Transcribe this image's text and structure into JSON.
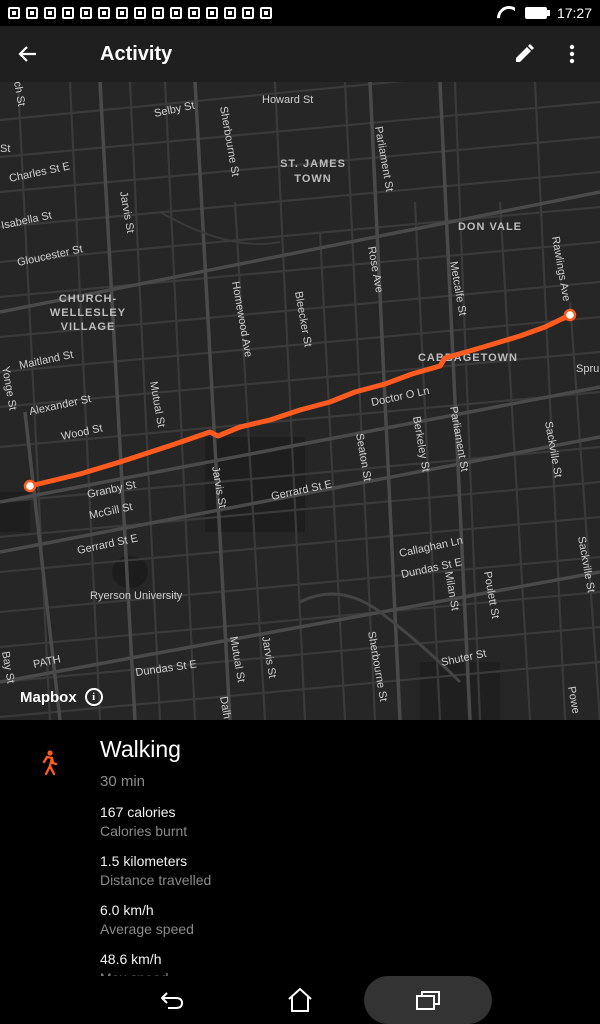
{
  "status_bar": {
    "time": "17:27"
  },
  "app_bar": {
    "title": "Activity"
  },
  "map": {
    "attribution": "Mapbox",
    "route_color": "#ff5a1f",
    "labels": {
      "howard_st": "Howard St",
      "selby_st": "Selby St",
      "charles_st_e": "Charles St E",
      "isabella_st": "Isabella St",
      "gloucester_st": "Gloucester St",
      "st_james_town": "ST. JAMES",
      "st_james_town_2": "TOWN",
      "don_vale": "DON VALE",
      "church_wellesley": "CHURCH-",
      "church_wellesley_2": "WELLESLEY",
      "church_wellesley_3": "VILLAGE",
      "maitland_st": "Maitland St",
      "alexander_st": "Alexander St",
      "wood_st": "Wood St",
      "granby_st": "Granby St",
      "mcgill_st": "McGill St",
      "gerrard_st_e_w": "Gerrard St E",
      "gerrard_st_e": "Gerrard St E",
      "ryerson_university": "Ryerson University",
      "dundas_st_e_w": "Dundas St E",
      "dundas_st_e": "Dundas St E",
      "callaghan_ln": "Callaghan Ln",
      "shuter_st": "Shuter St",
      "cabbagetown": "CABBAGETOWN",
      "doctor_o_ln": "Doctor O Ln",
      "path": "PATH",
      "jarvis_st": "Jarvis St",
      "jarvis_st_2": "Jarvis St",
      "jarvis_st_3": "Jarvis St",
      "sherbourne_st": "Sherbourne St",
      "sherbourne_st_2": "Sherbourne St",
      "parliament_st": "Parliament St",
      "parliament_st_2": "Parliament St",
      "homewood_ave": "Homewood Ave",
      "bleecker_st": "Bleecker St",
      "rose_ave": "Rose Ave",
      "metcalfe_st": "Metcalfe St",
      "rawlings_ave": "Rawlings Ave",
      "mutual_st": "Mutual St",
      "mutual_st_2": "Mutual St",
      "seaton_st": "Seaton St",
      "berkeley_st": "Berkeley St",
      "sackville_st": "Sackville St",
      "sackville_st_2": "Sackville St",
      "milan_st": "Milan St",
      "poulett_st": "Poulett St",
      "church_st": "ch St",
      "yonge_st": "Yonge St",
      "bay_st": "Bay St",
      "st_left": "St",
      "spruce": "Spru",
      "dalhousie": "Dalh",
      "power": "Powe"
    }
  },
  "activity": {
    "name": "Walking",
    "duration": "30 min",
    "stats": [
      {
        "value": "167 calories",
        "label": "Calories burnt"
      },
      {
        "value": "1.5 kilometers",
        "label": "Distance travelled"
      },
      {
        "value": "6.0 km/h",
        "label": "Average speed"
      },
      {
        "value": "48.6 km/h",
        "label": "Max speed"
      }
    ],
    "accent_color": "#ff5a1f"
  },
  "icons": {
    "back": "arrow-left-icon",
    "edit": "pencil-icon",
    "more": "more-vert-icon",
    "activity": "walking-icon",
    "info": "info-icon",
    "nav_back": "nav-back-icon",
    "nav_home": "home-icon",
    "nav_recents": "recents-icon"
  }
}
